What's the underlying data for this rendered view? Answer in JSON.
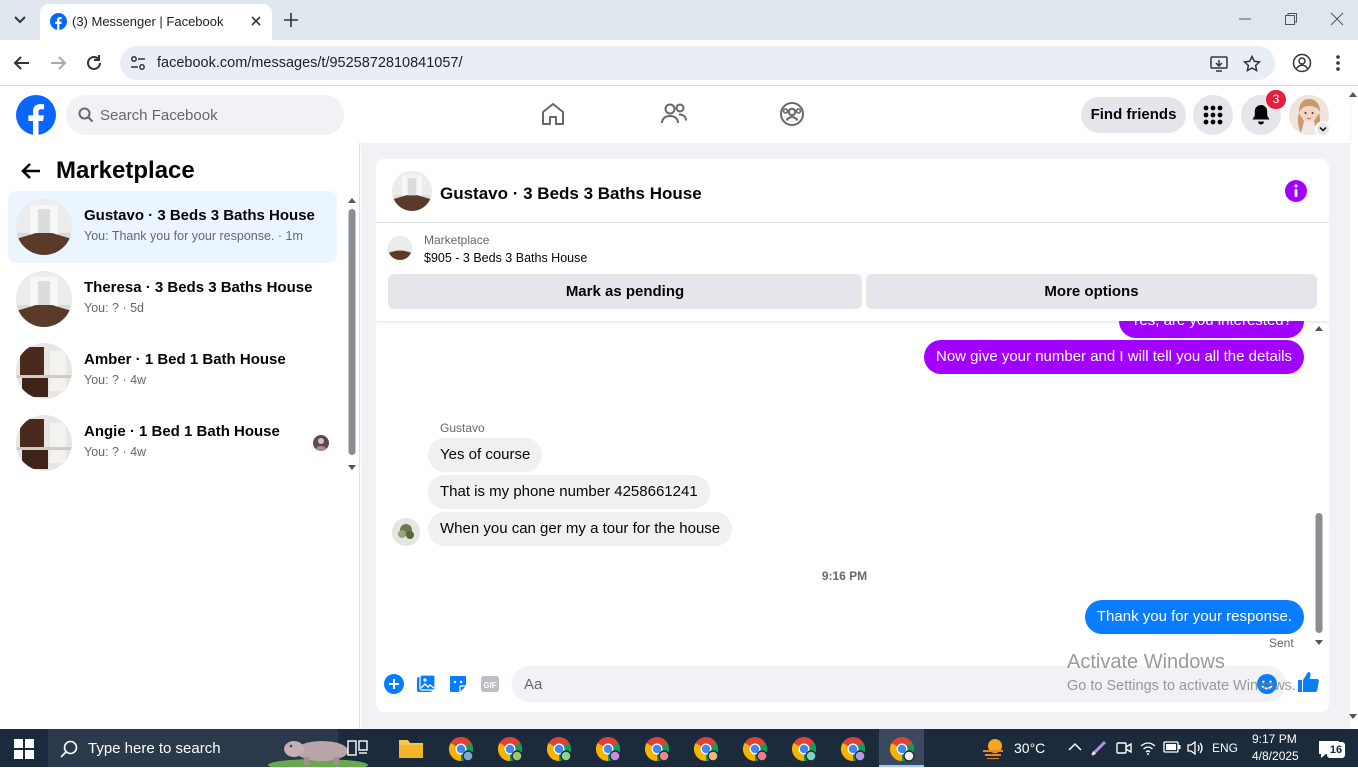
{
  "browser": {
    "tab_title": "(3) Messenger | Facebook",
    "url": "facebook.com/messages/t/9525872810841057/"
  },
  "fb": {
    "search_placeholder": "Search Facebook",
    "find_friends": "Find friends",
    "notification_count": "3"
  },
  "sidebar": {
    "title": "Marketplace",
    "conversations": [
      {
        "name": "Gustavo · 3 Beds 3 Baths House",
        "snippet": "You: Thank you for your response. · 1m",
        "active": true
      },
      {
        "name": "Theresa · 3 Beds 3 Baths House",
        "snippet": "You: ? · 5d",
        "active": false
      },
      {
        "name": "Amber · 1 Bed 1 Bath House",
        "snippet": "You: ? · 4w",
        "active": false
      },
      {
        "name": "Angie · 1 Bed 1 Bath House",
        "snippet": "You: ? · 4w",
        "active": false
      }
    ]
  },
  "chat": {
    "title": "Gustavo · 3 Beds 3 Baths House",
    "marketplace_label": "Marketplace",
    "listing": "$905 - 3 Beds 3 Baths House",
    "mark_pending": "Mark as pending",
    "more_options": "More options",
    "messages": {
      "cut_off": "Yes, are you interested?",
      "out1": "Now give your number and I will tell you all the details",
      "sender": "Gustavo",
      "in1": "Yes of course",
      "in2": "That is my phone number 4258661241",
      "in3": "When you can ger my a tour for the house",
      "timestamp": "9:16 PM",
      "out2": "Thank you for your response.",
      "status": "Sent"
    },
    "composer_placeholder": "Aa"
  },
  "watermark": {
    "title": "Activate Windows",
    "subtitle": "Go to Settings to activate Windows."
  },
  "taskbar": {
    "search_placeholder": "Type here to search",
    "temperature": "30°C",
    "language": "ENG",
    "time": "9:17 PM",
    "date": "4/8/2025",
    "notification_count": "16"
  },
  "colors": {
    "fb_blue": "#0866ff",
    "bubble_purple": "#a200ff",
    "bubble_blue": "#0a7cff",
    "badge_red": "#e41e3f"
  }
}
